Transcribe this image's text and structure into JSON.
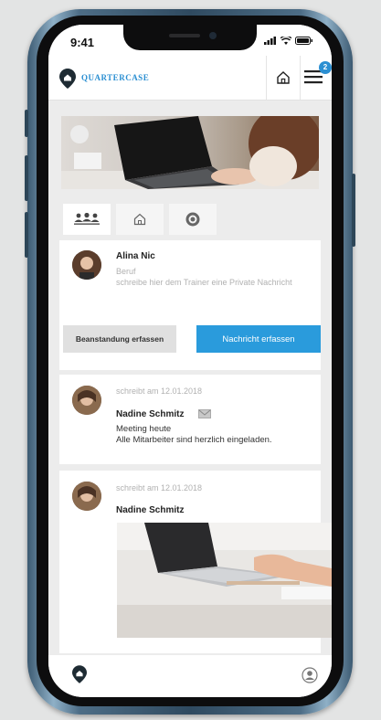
{
  "status_bar": {
    "time": "9:41"
  },
  "app": {
    "brand": "QUARTERCASE",
    "notification_count": "2"
  },
  "composer": {
    "name": "Alina Nic",
    "role": "Beruf",
    "placeholder": "schreibe hier dem Trainer eine Private Nachricht",
    "btn_complaint": "Beanstandung erfassen",
    "btn_message": "Nachricht erfassen"
  },
  "posts": [
    {
      "meta": "schreibt am 12.01.2018",
      "author": "Nadine Schmitz",
      "text_line1": "Meeting heute",
      "text_line2": "Alle Mitarbeiter sind herzlich eingeladen."
    },
    {
      "meta": "schreibt am 12.01.2018",
      "author": "Nadine Schmitz"
    }
  ],
  "colors": {
    "accent": "#2a9bdc",
    "frame": "#3c5a72"
  }
}
